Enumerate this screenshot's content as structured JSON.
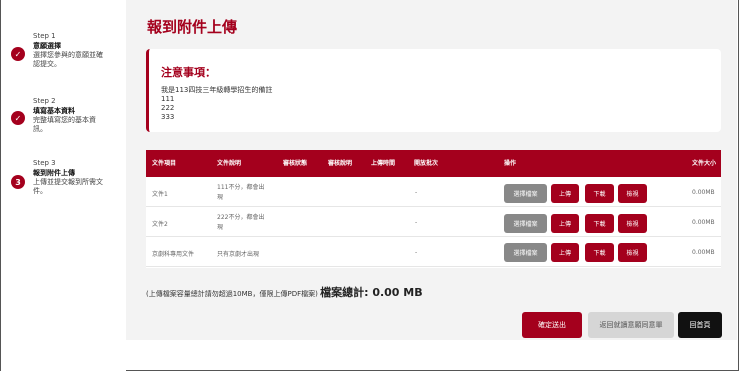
{
  "steps": [
    {
      "num": "Step 1",
      "title": "意願選擇",
      "desc": [
        "選擇您參與的意願並確",
        "認提交。"
      ],
      "badge": "✓"
    },
    {
      "num": "Step 2",
      "title": "填寫基本資料",
      "desc": [
        "完整填寫您的基本資",
        "訊。"
      ],
      "badge": "✓"
    },
    {
      "num": "Step 3",
      "title": "報到附件上傳",
      "desc": [
        "上傳並提交報到所需文",
        "件。"
      ],
      "badge": "3"
    }
  ],
  "page": {
    "title": "報到附件上傳"
  },
  "notice": {
    "title": "注意事項：",
    "lines": [
      "我是113四技三年級轉學招生的備註",
      "111",
      "222",
      "333"
    ]
  },
  "table": {
    "headers": {
      "item": "文件項目",
      "desc": "文件說明",
      "review_status": "審核狀態",
      "review_note": "審核說明",
      "upload_time": "上傳時間",
      "open_batch": "開放批次",
      "action": "操作",
      "size": "文件大小"
    },
    "rows": [
      {
        "item": "文件1",
        "desc": [
          "111不分，都會出",
          "現"
        ],
        "open_batch": "-",
        "size": "0.00MB"
      },
      {
        "item": "文件2",
        "desc": [
          "222不分，都會出",
          "現"
        ],
        "open_batch": "-",
        "size": "0.00MB"
      },
      {
        "item": "京劇科專用文件",
        "desc": [
          "只有京劇才出現",
          ""
        ],
        "open_batch": "-",
        "size": "0.00MB"
      }
    ],
    "actions": {
      "choose": "選擇檔案",
      "upload": "上傳",
      "download": "下載",
      "view": "檢視"
    }
  },
  "summary": {
    "note": "(上傳檔案容量總計請勿超過10MB，僅限上傳PDF檔案)",
    "total": "檔案總計: 0.00 MB"
  },
  "buttons": {
    "submit": "確定送出",
    "back": "返回就讀意願同意單",
    "home": "回首頁"
  },
  "colors": {
    "accent": "#a4001d",
    "gray": "#888888",
    "bg": "#f3f3f3"
  }
}
